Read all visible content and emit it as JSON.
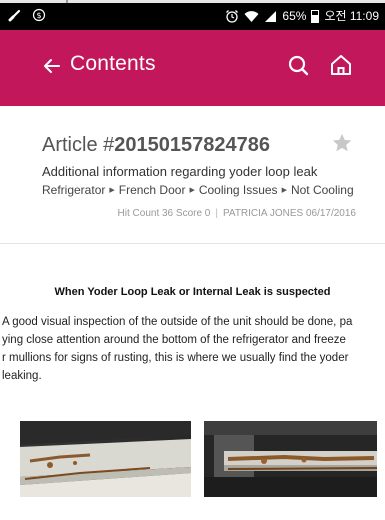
{
  "status_bar": {
    "battery": "65%",
    "time": "오전 11:09"
  },
  "app_bar": {
    "title": "Contents",
    "color": "#c2185b"
  },
  "article": {
    "number_prefix": "Article #",
    "number": "20150157824786",
    "subtitle": "Additional information regarding yoder loop leak",
    "breadcrumb": [
      "Refrigerator",
      "French Door",
      "Cooling Issues",
      "Not Cooling"
    ],
    "hit_count": "Hit Count 36 Score 0",
    "author_date": "PATRICIA JONES 06/17/2016"
  },
  "content": {
    "heading": "When Yoder Loop Leak or Internal Leak is suspected",
    "paragraph": "A good visual inspection of the outside of the unit should be done, pa\nying close attention around the bottom of the refrigerator and freeze\nr mullions for signs of rusting, this is where we usually find the yoder\nleaking."
  },
  "icons": [
    "back-arrow-icon",
    "search-icon",
    "home-icon",
    "star-icon"
  ]
}
